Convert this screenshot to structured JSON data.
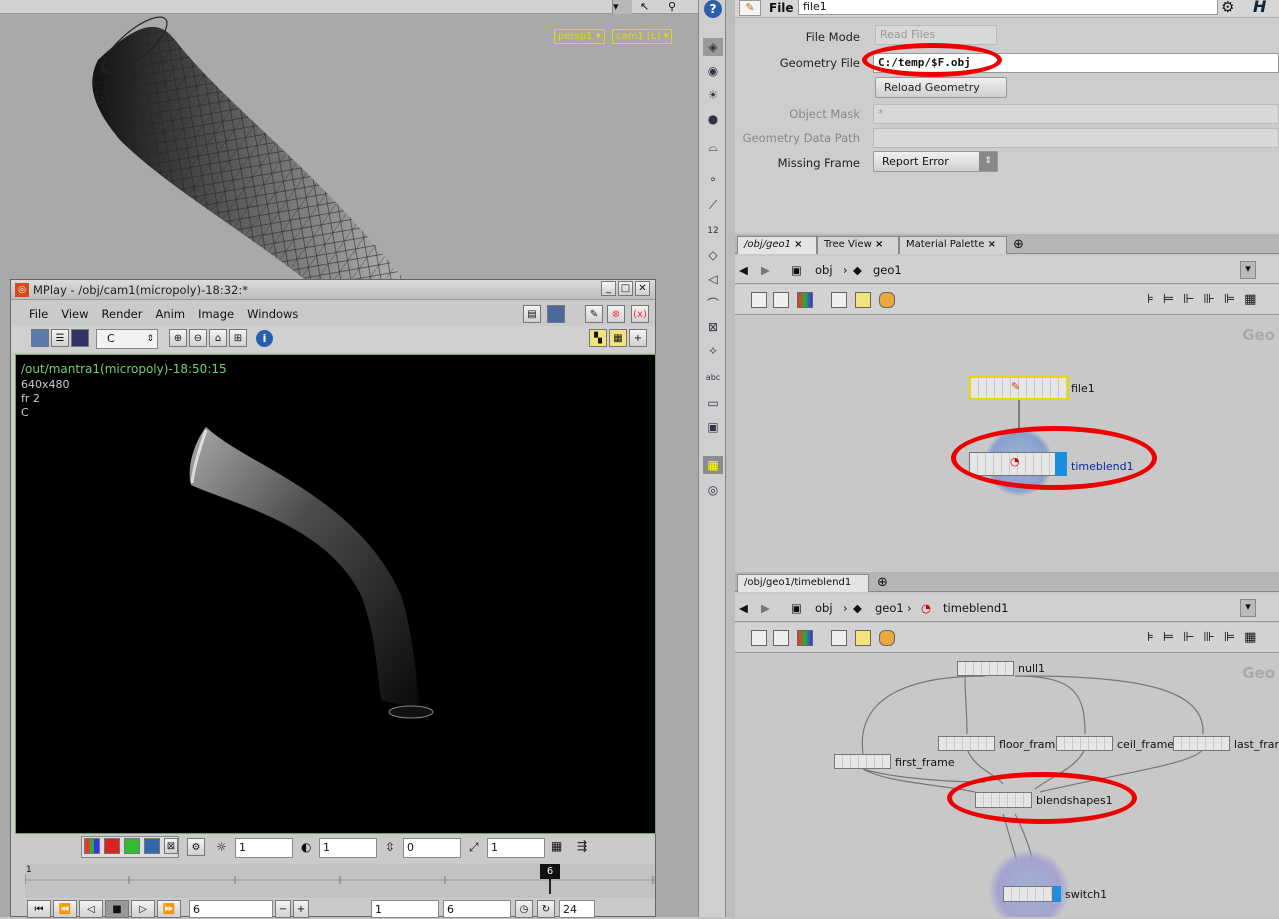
{
  "viewport": {
    "camera_persp": "persp1 ▾",
    "camera_cam": "cam1 [L] ▾"
  },
  "params": {
    "header_type": "File",
    "header_name": "file1",
    "file_mode_label": "File Mode",
    "file_mode_value": "Read Files",
    "geometry_file_label": "Geometry File",
    "geometry_file_value": "C:/temp/$F.obj",
    "reload_button": "Reload Geometry",
    "object_mask_label": "Object Mask",
    "object_mask_value": "*",
    "geo_data_path_label": "Geometry Data Path",
    "missing_frame_label": "Missing Frame",
    "missing_frame_value": "Report Error"
  },
  "network1": {
    "tabs": [
      "/obj/geo1",
      "Tree View",
      "Material Palette"
    ],
    "path": [
      "obj",
      "geo1"
    ],
    "context_label": "Geo",
    "nodes": {
      "file1": "file1",
      "timeblend1": "timeblend1"
    }
  },
  "network2": {
    "tabs": [
      "/obj/geo1/timeblend1"
    ],
    "path": [
      "obj",
      "geo1",
      "timeblend1"
    ],
    "context_label": "Geo",
    "nodes": {
      "null1": "null1",
      "floor_frame": "floor_frame",
      "ceil_frame": "ceil_frame",
      "last_frame": "last_fram",
      "first_frame": "first_frame",
      "blendshapes1": "blendshapes1",
      "switch1": "switch1"
    }
  },
  "mplay": {
    "title": "MPlay - /obj/cam1(micropoly)-18:32:*",
    "menu": [
      "File",
      "View",
      "Render",
      "Anim",
      "Image",
      "Windows"
    ],
    "channel": "C",
    "overlay_line1": "/out/mantra1(micropoly)-18:50:15",
    "overlay_line2": "640x480",
    "overlay_line3": "fr 2",
    "overlay_line4": "C",
    "gamma": "1",
    "exposure": "1",
    "offset": "0",
    "scale": "1",
    "timeline_start_label": "1",
    "current_frame_marker": "6",
    "current_frame": "6",
    "range_start": "1",
    "range_end": "6",
    "fps": "24"
  },
  "colors": {
    "accent_red": "#e00000",
    "render_green": "#6fa15a",
    "camera_yellow": "#e8d800"
  }
}
